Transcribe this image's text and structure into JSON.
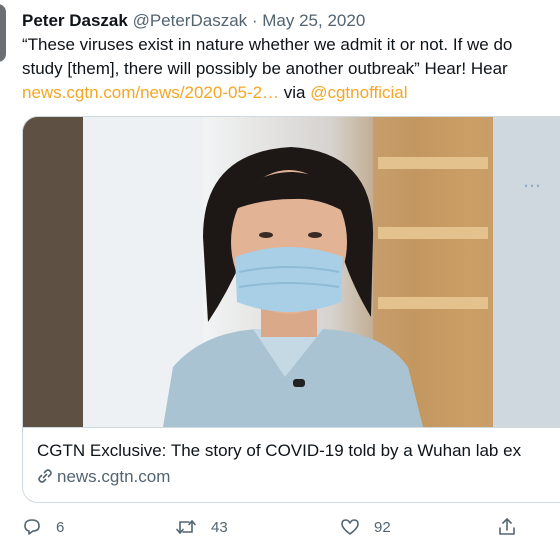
{
  "tweet": {
    "author_name": "Peter Daszak",
    "handle": "@PeterDaszak",
    "separator": " · ",
    "date": "May 25, 2020",
    "text_line1": "“These viruses exist in nature whether we admit it or not. If we do",
    "text_line2": "study [them], there will possibly be another outbreak” Hear! Hear",
    "link_text": "news.cgtn.com/news/2020-05-2…",
    "via_text": " via ",
    "via_handle": "@cgtnofficial"
  },
  "card": {
    "title": "CGTN Exclusive: The story of COVID-19 told by a Wuhan lab ex",
    "domain": "news.cgtn.com",
    "image_icon": "video-thumbnail-woman-in-mask"
  },
  "actions": {
    "reply_count": "6",
    "retweet_count": "43",
    "like_count": "92",
    "reply_icon": "comment-icon",
    "retweet_icon": "retweet-icon",
    "like_icon": "heart-icon",
    "share_icon": "share-icon"
  },
  "colors": {
    "link": "#f5a623",
    "meta": "#536471",
    "border": "#cfd9de"
  }
}
